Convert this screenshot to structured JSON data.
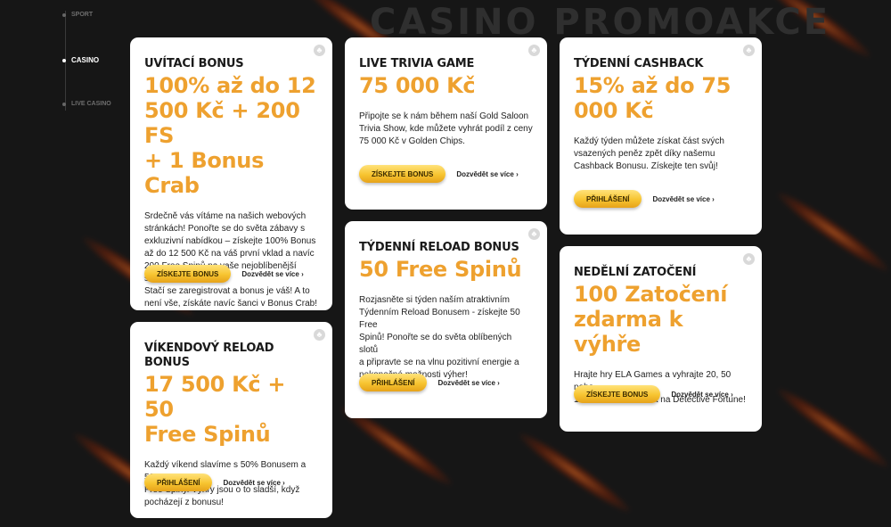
{
  "page": {
    "bg_title": "CASINO PROMOAKCE",
    "accent_color": "#eea12f",
    "button_color": "#f7c430"
  },
  "sidenav": {
    "items": [
      {
        "label": "SPORT",
        "active": false
      },
      {
        "label": "CASINO",
        "active": true
      },
      {
        "label": "LIVE CASINO",
        "active": false
      }
    ]
  },
  "cards": {
    "welcome": {
      "label": "UVÍTACÍ BONUS",
      "headline_lines": [
        "100% až do 12",
        "500 Kč + 200 FS",
        "+ 1 Bonus Crab"
      ],
      "desc_lines": [
        "Srdečně vás vítáme na našich webových",
        "stránkách! Ponořte se do světa zábavy s",
        "exkluzivní nabídkou – získejte 100% Bonus",
        "až do 12 500 Kč na váš první vklad a navíc",
        "200 Free Spinů na vaše nejoblíbenější sloty.",
        "Stačí se zaregistrovat a bonus je váš! A to",
        "není vše, získáte navíc šanci v Bonus Crab!"
      ],
      "button": "ZÍSKEJTE BONUS",
      "more": "Dozvědět se více"
    },
    "trivia": {
      "label": "LIVE TRIVIA GAME",
      "headline_lines": [
        "75 000 Kč"
      ],
      "desc_lines": [
        "Připojte se k nám během naší Gold Saloon",
        "Trivia Show, kde můžete vyhrát podíl z ceny",
        "75 000 Kč v Golden Chips."
      ],
      "button": "ZÍSKEJTE BONUS",
      "more": "Dozvědět se více"
    },
    "cashback": {
      "label": "TÝDENNÍ CASHBACK",
      "headline_lines": [
        "15% až do 75",
        "000 Kč"
      ],
      "desc_lines": [
        "Každý týden můžete získat část svých",
        "vsazených peněz zpět díky našemu",
        "Cashback Bonusu. Získejte ten svůj!"
      ],
      "button": "PŘIHLÁŠENÍ",
      "more": "Dozvědět se více"
    },
    "reload": {
      "label": "TÝDENNÍ RELOAD BONUS",
      "headline_lines": [
        "50 Free Spinů"
      ],
      "desc_lines": [
        "Rozjasněte si týden naším atraktivním",
        "Týdenním Reload Bonusem - získejte 50 Free",
        "Spinů! Ponořte se do světa oblíbených slotů",
        "a připravte se na vlnu pozitivní energie a",
        "nekonečné možnosti výher!"
      ],
      "button": "PŘIHLÁŠENÍ",
      "more": "Dozvědět se více"
    },
    "sunday": {
      "label": "NEDĚLNÍ ZATOČENÍ",
      "headline_lines": [
        "100 Zatočení",
        "zdarma k výhře"
      ],
      "desc_lines": [
        "Hrajte hry ELA Games a vyhrajte 20, 50 nebo",
        "100 Zatočení zdarma na Detective Fortune!"
      ],
      "button": "ZÍSKEJTE BONUS",
      "more": "Dozvědět se více"
    },
    "weekend": {
      "label": "VÍKENDOVÝ RELOAD BONUS",
      "headline_lines": [
        "17 500 Kč + 50",
        "Free Spinů"
      ],
      "desc_lines": [
        "Každý víkend slavíme s 50% Bonusem a 50",
        "Free Spiny. Výhry jsou o to sladší, když",
        "pocházejí z bonusu!"
      ],
      "button": "PŘIHLÁŠENÍ",
      "more": "Dozvědět se více"
    }
  }
}
